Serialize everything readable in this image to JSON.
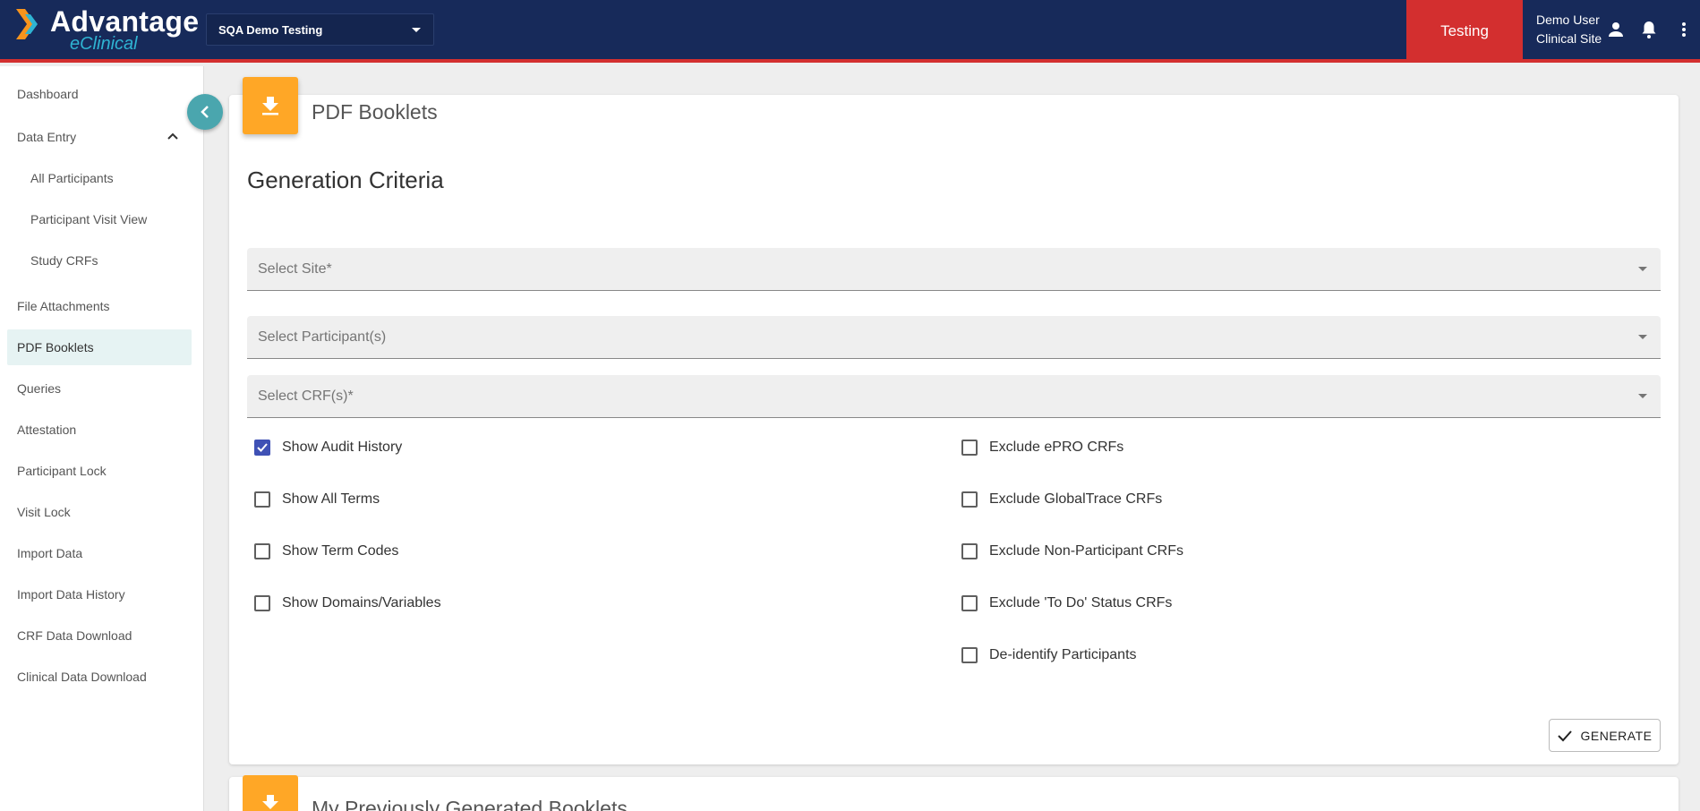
{
  "header": {
    "logo_primary": "Advantage",
    "logo_secondary": "eClinical",
    "study_selector": "SQA Demo Testing",
    "environment": "Testing",
    "user_name": "Demo User",
    "user_role": "Clinical Site",
    "icons": [
      "person-icon",
      "bell-icon",
      "more-vert-icon"
    ]
  },
  "sidebar": {
    "items": [
      {
        "label": "Dashboard"
      },
      {
        "label": "Data Entry"
      },
      {
        "label": "All Participants"
      },
      {
        "label": "Participant Visit View"
      },
      {
        "label": "Study CRFs"
      },
      {
        "label": "File Attachments"
      },
      {
        "label": "PDF Booklets"
      },
      {
        "label": "Queries"
      },
      {
        "label": "Attestation"
      },
      {
        "label": "Participant Lock"
      },
      {
        "label": "Visit Lock"
      },
      {
        "label": "Import Data"
      },
      {
        "label": "Import Data History"
      },
      {
        "label": "CRF Data Download"
      },
      {
        "label": "Clinical Data Download"
      }
    ],
    "active": "PDF Booklets",
    "expanded_group": "Data Entry"
  },
  "main": {
    "page_title": "PDF Booklets",
    "section_title": "Generation Criteria",
    "fields": {
      "site": {
        "label": "Select Site*",
        "value": ""
      },
      "participants": {
        "label": "Select Participant(s)",
        "value": ""
      },
      "crfs": {
        "label": "Select CRF(s)*",
        "value": ""
      }
    },
    "left_options": [
      {
        "label": "Show Audit History",
        "checked": true
      },
      {
        "label": "Show All Terms",
        "checked": false
      },
      {
        "label": "Show Term Codes",
        "checked": false
      },
      {
        "label": "Show Domains/Variables",
        "checked": false
      }
    ],
    "right_options": [
      {
        "label": "Exclude ePRO CRFs",
        "checked": false
      },
      {
        "label": "Exclude GlobalTrace CRFs",
        "checked": false
      },
      {
        "label": "Exclude Non-Participant CRFs",
        "checked": false
      },
      {
        "label": "Exclude 'To Do' Status CRFs",
        "checked": false
      },
      {
        "label": "De-identify Participants",
        "checked": false
      }
    ],
    "generate_label": "GENERATE",
    "next_card_title": "My Previously Generated Booklets"
  },
  "colors": {
    "header_bg": "#172a5a",
    "env_badge": "#d32f2f",
    "accent_orange": "#ffa726",
    "collapse_teal": "#4aa6ae",
    "checkbox_checked": "#3f51b5",
    "active_nav_bg": "#e6f3f3"
  }
}
